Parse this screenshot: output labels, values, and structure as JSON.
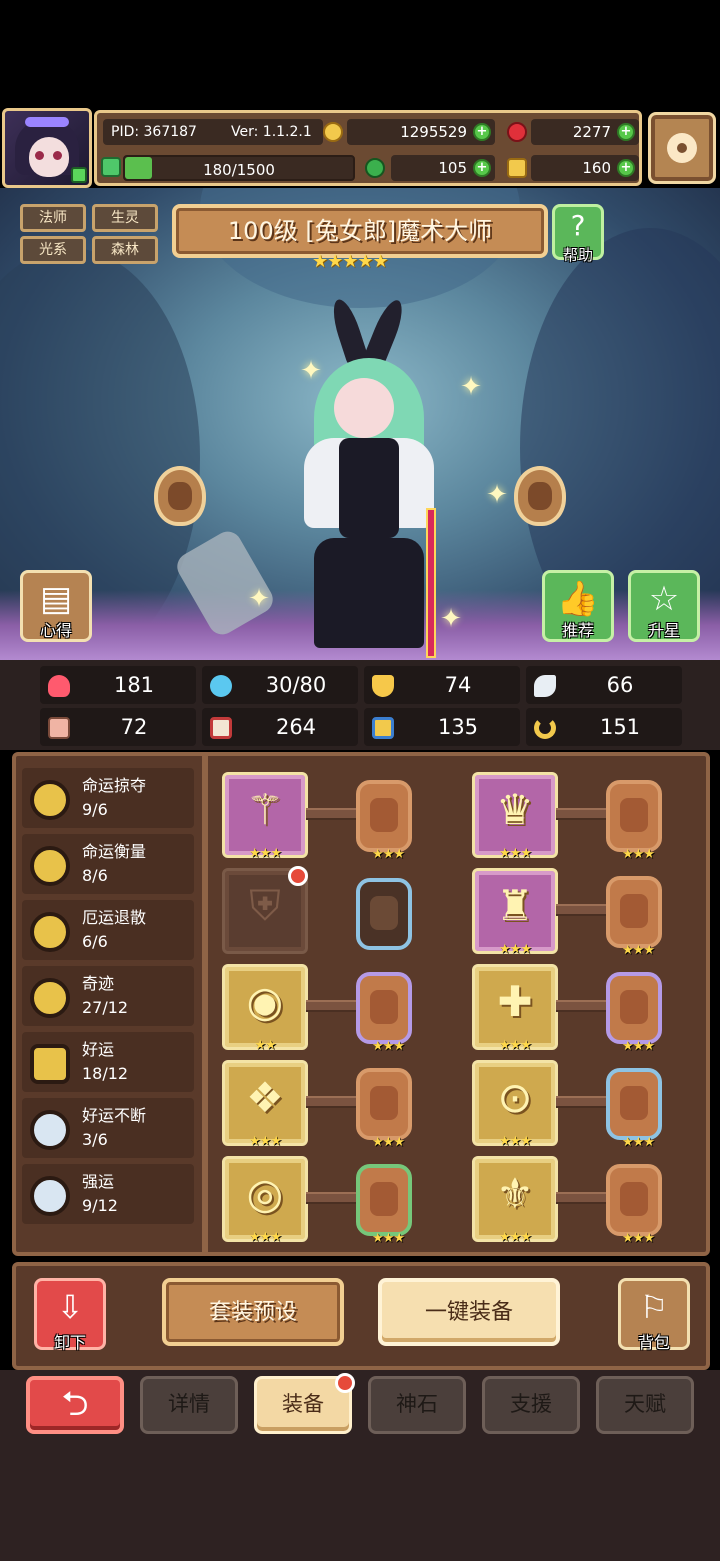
{
  "hud": {
    "pid": "PID: 367187",
    "version": "Ver: 1.1.2.1",
    "exp": "180/1500",
    "gold": "1295529",
    "gems": "2277",
    "clover": "105",
    "key": "160",
    "exp_fill_fraction": 0.12
  },
  "character": {
    "tags": [
      "法师",
      "生灵",
      "光系",
      "森林"
    ],
    "title": "100级  [兔女郎]魔术大师",
    "stars": "★★★★★",
    "help_label": "帮助",
    "notes_label": "心得",
    "recommend_label": "推荐",
    "star_up_label": "升星"
  },
  "stats": {
    "row1": [
      "181",
      "30/80",
      "74",
      "66"
    ],
    "row2": [
      "72",
      "264",
      "135",
      "151"
    ]
  },
  "sets": [
    {
      "name": "命运掠夺",
      "count": "9/6",
      "medal": "gold"
    },
    {
      "name": "命运衡量",
      "count": "8/6",
      "medal": "gold"
    },
    {
      "name": "厄运退散",
      "count": "6/6",
      "medal": "gold"
    },
    {
      "name": "奇迹",
      "count": "27/12",
      "medal": "gold"
    },
    {
      "name": "好运",
      "count": "18/12",
      "medal": "gold"
    },
    {
      "name": "好运不断",
      "count": "3/6",
      "medal": "silver"
    },
    {
      "name": "强运",
      "count": "9/12",
      "medal": "silver"
    }
  ],
  "equipment": {
    "star3": "★★★",
    "star2": "★★"
  },
  "actions": {
    "unequip_label": "卸下",
    "preset_label": "套装预设",
    "auto_equip_label": "一键装备",
    "bag_label": "背包"
  },
  "tabs": {
    "back_symbol": "⮌",
    "items": [
      "详情",
      "装备",
      "神石",
      "支援",
      "天赋"
    ],
    "active": "装备"
  },
  "colors": {
    "gold_accent": "#e9c88a",
    "panel_brown": "#5a3a2a",
    "red_button": "#e24a4a",
    "green_button": "#5bb75a"
  }
}
